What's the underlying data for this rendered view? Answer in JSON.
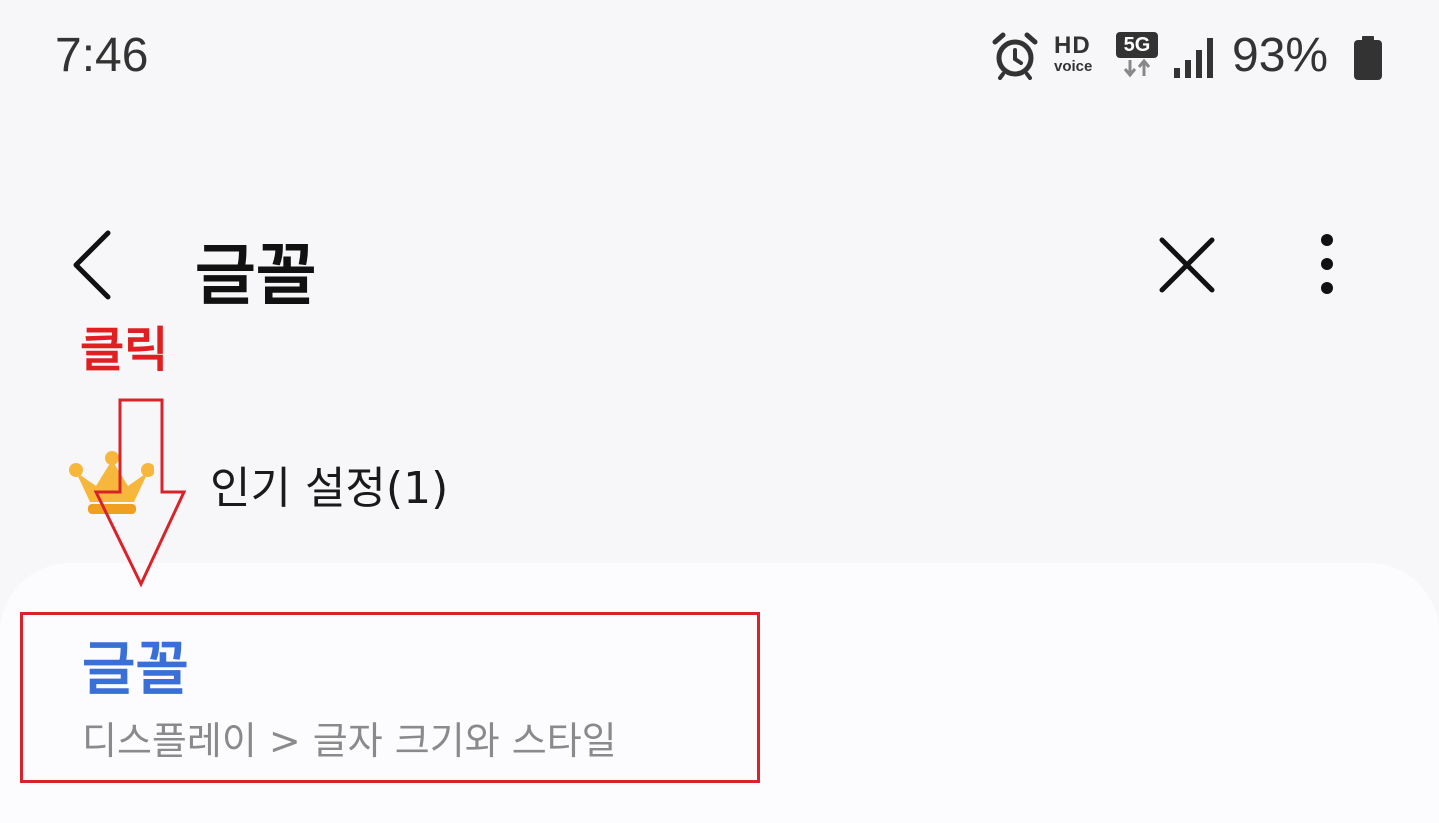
{
  "status_bar": {
    "time": "7:46",
    "battery_pct": "93%",
    "hd_text": "HD",
    "voice_text": "voice",
    "network_text": "5G",
    "icons": [
      "alarm-icon",
      "hd-voice-icon",
      "5g-icon",
      "signal-icon",
      "battery-icon"
    ]
  },
  "toolbar": {
    "title": "글꼴",
    "back_icon": "chevron-left-icon",
    "close_icon": "close-icon",
    "more_icon": "more-vertical-icon"
  },
  "annotation": {
    "label": "클릭",
    "color": "#e02020"
  },
  "popular": {
    "icon": "crown-icon",
    "label": "인기 설정(1)"
  },
  "result": {
    "title": "글꼴",
    "path": "디스플레이 > 글자 크기와 스타일",
    "title_color": "#3a6fd8"
  }
}
